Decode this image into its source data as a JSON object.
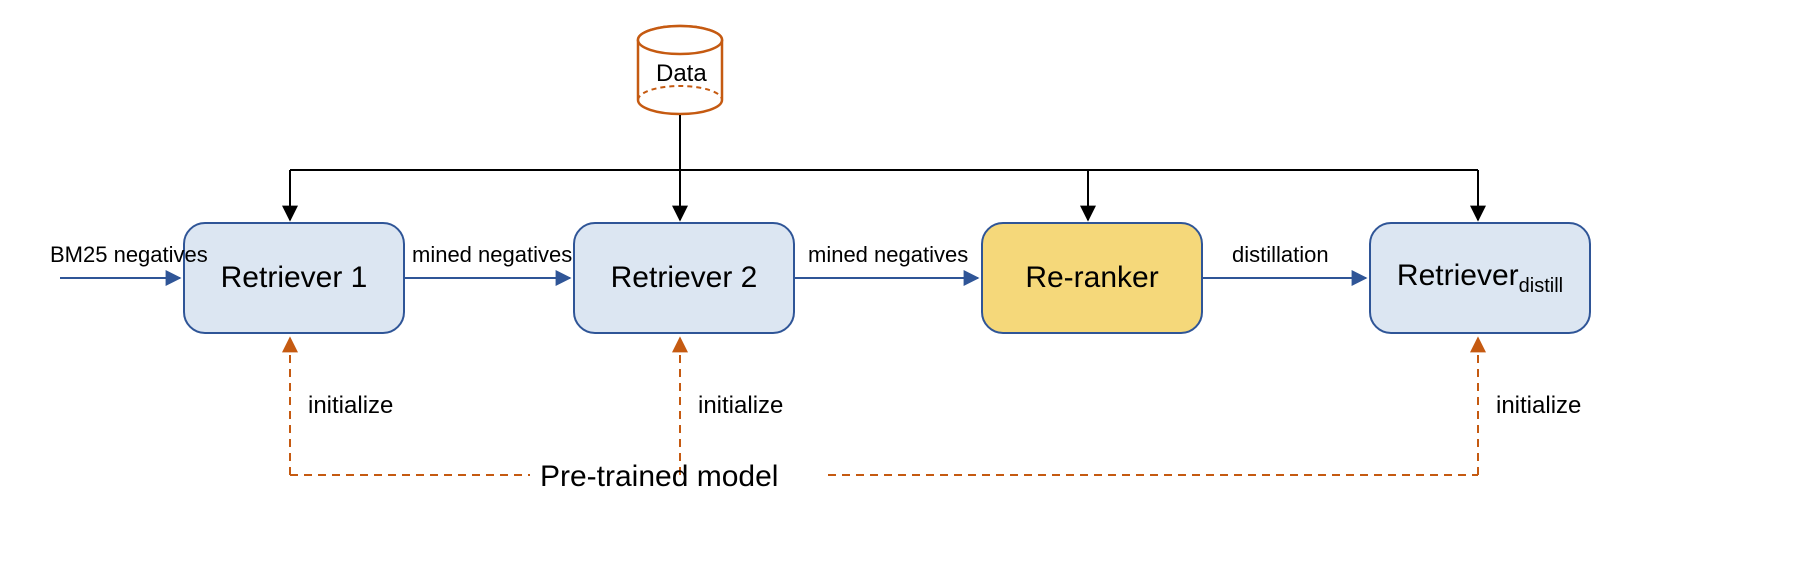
{
  "cylinder": {
    "label": "Data"
  },
  "boxes": {
    "retriever1": "Retriever 1",
    "retriever2": "Retriever 2",
    "reranker": "Re-ranker",
    "retriever_distill_main": "Retriever",
    "retriever_distill_sub": "distill"
  },
  "edges": {
    "bm25": "BM25 negatives",
    "mined1": "mined negatives",
    "mined2": "mined negatives",
    "distillation": "distillation",
    "init1": "initialize",
    "init2": "initialize",
    "init3": "initialize",
    "pretrained": "Pre-trained model"
  },
  "colors": {
    "blue_stroke": "#2f5597",
    "blue_fill": "#dce6f2",
    "yellow_fill": "#f5d87a",
    "orange": "#c55a11",
    "black": "#000000",
    "blue_arrow": "#2f5597"
  }
}
